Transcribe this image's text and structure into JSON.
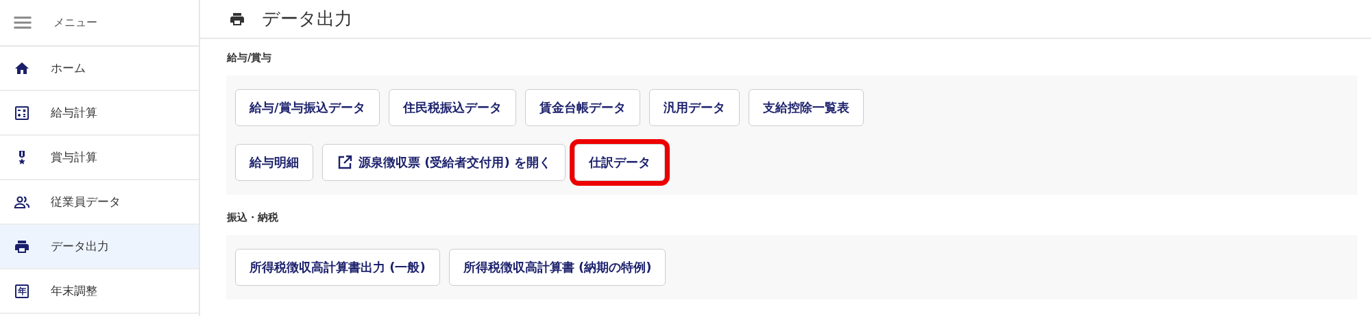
{
  "sidebar": {
    "menu_label": "メニュー",
    "items": [
      {
        "label": "ホーム",
        "kind": "home",
        "selected": false
      },
      {
        "label": "給与計算",
        "kind": "calculator",
        "selected": false
      },
      {
        "label": "賞与計算",
        "kind": "medal",
        "selected": false
      },
      {
        "label": "従業員データ",
        "kind": "people",
        "selected": false
      },
      {
        "label": "データ出力",
        "kind": "printer",
        "selected": true
      },
      {
        "label": "年末調整",
        "kind": "glyph",
        "glyph": "年",
        "selected": false
      }
    ]
  },
  "header": {
    "title": "データ出力"
  },
  "sections": [
    {
      "label": "給与/賞与",
      "rows": [
        [
          {
            "label": "給与/賞与振込データ",
            "external": false,
            "highlighted": false
          },
          {
            "label": "住民税振込データ",
            "external": false,
            "highlighted": false
          },
          {
            "label": "賃金台帳データ",
            "external": false,
            "highlighted": false
          },
          {
            "label": "汎用データ",
            "external": false,
            "highlighted": false
          },
          {
            "label": "支給控除一覧表",
            "external": false,
            "highlighted": false
          }
        ],
        [
          {
            "label": "給与明細",
            "external": false,
            "highlighted": false
          },
          {
            "label": "源泉徴収票 (受給者交付用) を開く",
            "external": true,
            "highlighted": false
          },
          {
            "label": "仕訳データ",
            "external": false,
            "highlighted": true
          }
        ]
      ]
    },
    {
      "label": "振込・納税",
      "rows": [
        [
          {
            "label": "所得税徴収高計算書出力 (一般)",
            "external": false,
            "highlighted": false
          },
          {
            "label": "所得税徴収高計算書 (納期の特例)",
            "external": false,
            "highlighted": false
          }
        ]
      ]
    }
  ]
}
